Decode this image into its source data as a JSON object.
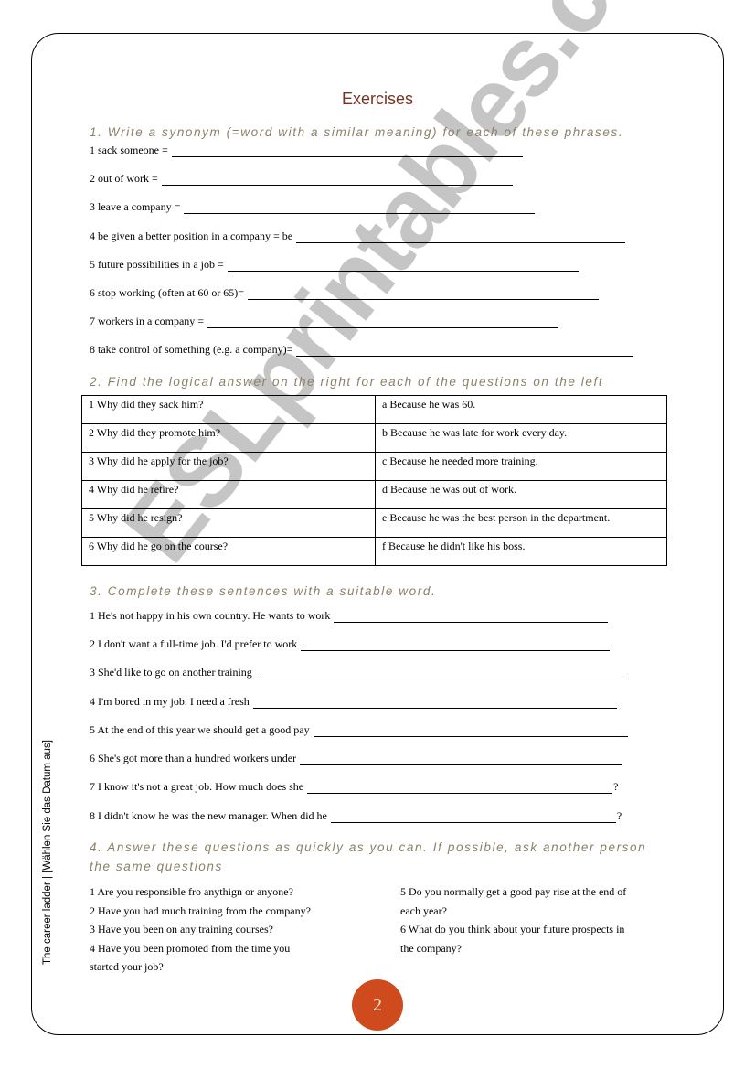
{
  "title": "Exercises",
  "watermark": "ESLprintables.com",
  "side_label": "The career ladder  |   [Wählen Sie das Datum aus]",
  "page_number": "2",
  "colors": {
    "title": "#7a3322",
    "heading": "#8c8068",
    "page_circle": "#cf4b1e"
  },
  "section1": {
    "heading": "1. Write a synonym (=word with a similar meaning) for each of these phrases.",
    "items": [
      "1 sack someone =",
      "2 out of work =",
      "3 leave a company =",
      "4 be given a better position in a company = be",
      "5 future possibilities in a job =",
      "6 stop working (often at 60 or 65)=",
      "7 workers in a company =",
      "8 take control of something (e.g. a company)="
    ]
  },
  "section2": {
    "heading": "2. Find the logical answer on the right for each of the questions on the left",
    "rows": [
      {
        "question": "1 Why did they sack him?",
        "answer": "a Because he was 60."
      },
      {
        "question": "2 Why did they promote him?",
        "answer": "b Because he was late for work every day."
      },
      {
        "question": "3 Why did he apply for the job?",
        "answer": "c Because he needed more training."
      },
      {
        "question": "4 Why did he retire?",
        "answer": "d Because he was out of work."
      },
      {
        "question": "5 Why did he resign?",
        "answer": "e Because he was the best person in the department."
      },
      {
        "question": "6 Why did he go on the course?",
        "answer": "f Because he didn't like his boss."
      }
    ]
  },
  "section3": {
    "heading": "3. Complete these sentences with a suitable word.",
    "items": [
      {
        "text": "1 He's not happy in his own country.  He wants to work",
        "end": ""
      },
      {
        "text": "2 I  don't want a full-time job. I'd prefer to work",
        "end": ""
      },
      {
        "text": "3 She'd like to go on another training",
        "end": ""
      },
      {
        "text": "4 I'm bored in my job. I need a fresh",
        "end": ""
      },
      {
        "text": "5 At the end of this year we should get a good pay",
        "end": ""
      },
      {
        "text": "6 She's got more than a hundred workers under",
        "end": ""
      },
      {
        "text": "7 I know it's not a great job.  How much does she",
        "end": "?"
      },
      {
        "text": "8 I didn't know he was the new manager.  When did he",
        "end": "?"
      }
    ]
  },
  "section4": {
    "heading_line1": "4. Answer these questions as quickly as you can. If possible, ask another person",
    "heading_line2": "the same questions",
    "left_column": [
      "1 Are you responsible fro anythign or anyone?",
      "2 Have you had much training from the company?",
      "3 Have you been on any training courses?",
      "4 Have you been promoted from the time you",
      "started your job?"
    ],
    "right_column": [
      "5 Do you normally get a good pay rise at the end of",
      "each year?",
      "6 What do you think about your future prospects in",
      "the company?"
    ]
  }
}
